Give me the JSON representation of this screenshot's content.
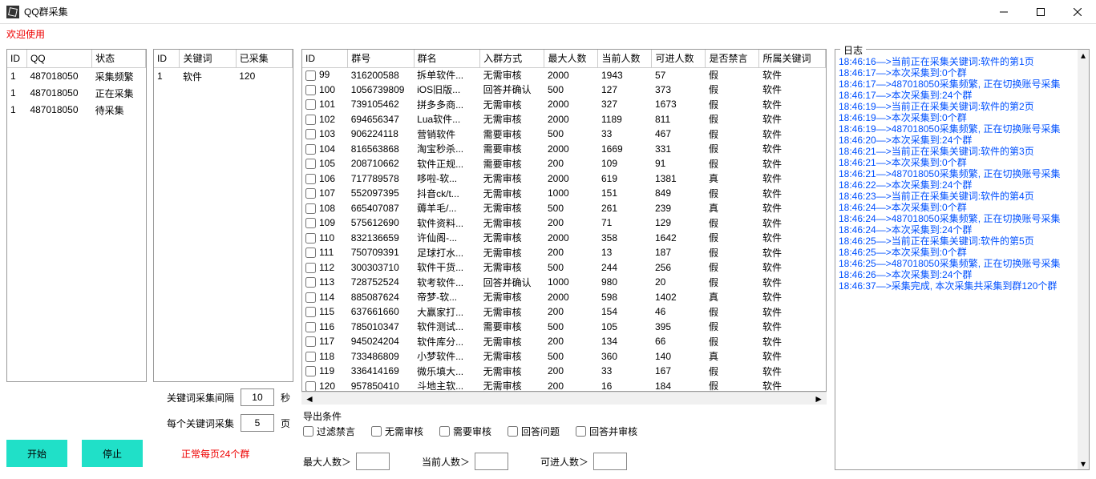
{
  "window": {
    "title": "QQ群采集"
  },
  "welcome": "欢迎使用",
  "accounts": {
    "headers": [
      "ID",
      "QQ",
      "状态"
    ],
    "rows": [
      {
        "id": "1",
        "qq": "487018050",
        "status": "采集频繁"
      },
      {
        "id": "1",
        "qq": "487018050",
        "status": "正在采集"
      },
      {
        "id": "1",
        "qq": "487018050",
        "status": "待采集"
      }
    ]
  },
  "keywords": {
    "headers": [
      "ID",
      "关键词",
      "已采集"
    ],
    "rows": [
      {
        "id": "1",
        "kw": "软件",
        "count": "120"
      }
    ]
  },
  "controls": {
    "intervalLabel": "关键词采集间隔",
    "intervalValue": "10",
    "intervalUnit": "秒",
    "pagesLabel": "每个关键词采集",
    "pagesValue": "5",
    "pagesUnit": "页",
    "startBtn": "开始",
    "stopBtn": "停止",
    "note": "正常每页24个群"
  },
  "groups": {
    "headers": [
      "ID",
      "群号",
      "群名",
      "入群方式",
      "最大人数",
      "当前人数",
      "可进人数",
      "是否禁言",
      "所属关键词"
    ],
    "rows": [
      {
        "id": "99",
        "no": "316200588",
        "name": "拆单软件...",
        "join": "无需审核",
        "max": "2000",
        "cur": "1943",
        "avail": "57",
        "ban": "假",
        "kw": "软件"
      },
      {
        "id": "100",
        "no": "1056739809",
        "name": "iOS旧版...",
        "join": "回答并确认",
        "max": "500",
        "cur": "127",
        "avail": "373",
        "ban": "假",
        "kw": "软件"
      },
      {
        "id": "101",
        "no": "739105462",
        "name": "拼多多商...",
        "join": "无需审核",
        "max": "2000",
        "cur": "327",
        "avail": "1673",
        "ban": "假",
        "kw": "软件"
      },
      {
        "id": "102",
        "no": "694656347",
        "name": "Lua软件...",
        "join": "无需审核",
        "max": "2000",
        "cur": "1189",
        "avail": "811",
        "ban": "假",
        "kw": "软件"
      },
      {
        "id": "103",
        "no": "906224118",
        "name": "营销软件",
        "join": "需要审核",
        "max": "500",
        "cur": "33",
        "avail": "467",
        "ban": "假",
        "kw": "软件"
      },
      {
        "id": "104",
        "no": "816563868",
        "name": "淘宝秒杀...",
        "join": "需要审核",
        "max": "2000",
        "cur": "1669",
        "avail": "331",
        "ban": "假",
        "kw": "软件"
      },
      {
        "id": "105",
        "no": "208710662",
        "name": "软件正规...",
        "join": "需要审核",
        "max": "200",
        "cur": "109",
        "avail": "91",
        "ban": "假",
        "kw": "软件"
      },
      {
        "id": "106",
        "no": "717789578",
        "name": "哆啦-软...",
        "join": "无需审核",
        "max": "2000",
        "cur": "619",
        "avail": "1381",
        "ban": "真",
        "kw": "软件"
      },
      {
        "id": "107",
        "no": "552097395",
        "name": "抖音ck/t...",
        "join": "无需审核",
        "max": "1000",
        "cur": "151",
        "avail": "849",
        "ban": "假",
        "kw": "软件"
      },
      {
        "id": "108",
        "no": "665407087",
        "name": "薅羊毛/...",
        "join": "无需审核",
        "max": "500",
        "cur": "261",
        "avail": "239",
        "ban": "真",
        "kw": "软件"
      },
      {
        "id": "109",
        "no": "575612690",
        "name": "软件资料...",
        "join": "无需审核",
        "max": "200",
        "cur": "71",
        "avail": "129",
        "ban": "假",
        "kw": "软件"
      },
      {
        "id": "110",
        "no": "832136659",
        "name": "许仙阁-...",
        "join": "无需审核",
        "max": "2000",
        "cur": "358",
        "avail": "1642",
        "ban": "假",
        "kw": "软件"
      },
      {
        "id": "111",
        "no": "750709391",
        "name": "足球打水...",
        "join": "无需审核",
        "max": "200",
        "cur": "13",
        "avail": "187",
        "ban": "假",
        "kw": "软件"
      },
      {
        "id": "112",
        "no": "300303710",
        "name": "软件干货...",
        "join": "无需审核",
        "max": "500",
        "cur": "244",
        "avail": "256",
        "ban": "假",
        "kw": "软件"
      },
      {
        "id": "113",
        "no": "728752524",
        "name": "软考软件...",
        "join": "回答并确认",
        "max": "1000",
        "cur": "980",
        "avail": "20",
        "ban": "假",
        "kw": "软件"
      },
      {
        "id": "114",
        "no": "885087624",
        "name": "帝梦-软...",
        "join": "无需审核",
        "max": "2000",
        "cur": "598",
        "avail": "1402",
        "ban": "真",
        "kw": "软件"
      },
      {
        "id": "115",
        "no": "637661660",
        "name": "大赢家打...",
        "join": "无需审核",
        "max": "200",
        "cur": "154",
        "avail": "46",
        "ban": "假",
        "kw": "软件"
      },
      {
        "id": "116",
        "no": "785010347",
        "name": "软件测试...",
        "join": "需要审核",
        "max": "500",
        "cur": "105",
        "avail": "395",
        "ban": "假",
        "kw": "软件"
      },
      {
        "id": "117",
        "no": "945024204",
        "name": "软件库分...",
        "join": "无需审核",
        "max": "200",
        "cur": "134",
        "avail": "66",
        "ban": "假",
        "kw": "软件"
      },
      {
        "id": "118",
        "no": "733486809",
        "name": "小梦软件...",
        "join": "无需审核",
        "max": "500",
        "cur": "360",
        "avail": "140",
        "ban": "真",
        "kw": "软件"
      },
      {
        "id": "119",
        "no": "336414169",
        "name": "微乐填大...",
        "join": "无需审核",
        "max": "200",
        "cur": "33",
        "avail": "167",
        "ban": "假",
        "kw": "软件"
      },
      {
        "id": "120",
        "no": "957850410",
        "name": "斗地主软...",
        "join": "无需审核",
        "max": "200",
        "cur": "16",
        "avail": "184",
        "ban": "假",
        "kw": "软件"
      }
    ]
  },
  "export": {
    "title": "导出条件",
    "cb1": "过滤禁言",
    "cb2": "无需审核",
    "cb3": "需要审核",
    "cb4": "回答问题",
    "cb5": "回答并审核",
    "maxLabel": "最大人数＞",
    "curLabel": "当前人数＞",
    "availLabel": "可进人数＞"
  },
  "log": {
    "label": "日志",
    "lines": [
      "18:46:16—>当前正在采集关键词:软件的第1页",
      "18:46:17—>本次采集到:0个群",
      "18:46:17—>487018050采集频繁, 正在切换账号采集",
      "18:46:17—>本次采集到:24个群",
      "18:46:19—>当前正在采集关键词:软件的第2页",
      "18:46:19—>本次采集到:0个群",
      "18:46:19—>487018050采集频繁, 正在切换账号采集",
      "18:46:20—>本次采集到:24个群",
      "18:46:21—>当前正在采集关键词:软件的第3页",
      "18:46:21—>本次采集到:0个群",
      "18:46:21—>487018050采集频繁, 正在切换账号采集",
      "18:46:22—>本次采集到:24个群",
      "18:46:23—>当前正在采集关键词:软件的第4页",
      "18:46:24—>本次采集到:0个群",
      "18:46:24—>487018050采集频繁, 正在切换账号采集",
      "18:46:24—>本次采集到:24个群",
      "18:46:25—>当前正在采集关键词:软件的第5页",
      "18:46:25—>本次采集到:0个群",
      "18:46:25—>487018050采集频繁, 正在切换账号采集",
      "18:46:26—>本次采集到:24个群",
      "18:46:37—>采集完成, 本次采集共采集到群120个群"
    ]
  }
}
